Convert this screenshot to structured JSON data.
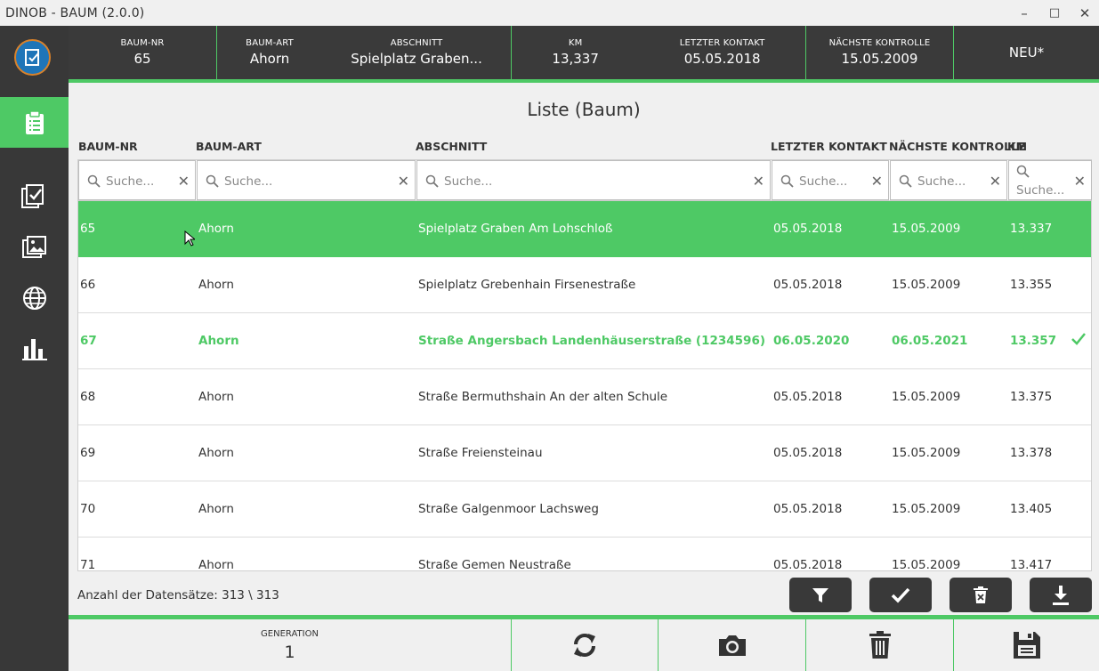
{
  "window": {
    "title": "DINOB - BAUM (2.0.0)",
    "minimize": "–",
    "maximize": "□",
    "close": "✕"
  },
  "header": {
    "baum_nr": {
      "label": "BAUM-NR",
      "value": "65"
    },
    "baum_art": {
      "label": "BAUM-ART",
      "value": "Ahorn"
    },
    "abschnitt": {
      "label": "ABSCHNITT",
      "value": "Spielplatz Graben..."
    },
    "km": {
      "label": "KM",
      "value": "13,337"
    },
    "letzter_kontakt": {
      "label": "LETZTER KONTAKT",
      "value": "05.05.2018"
    },
    "naechste_kontrolle": {
      "label": "NÄCHSTE KONTROLLE",
      "value": "15.05.2009"
    },
    "neu": "NEU*"
  },
  "list": {
    "title": "Liste (Baum)",
    "columns": [
      "BAUM-NR",
      "BAUM-ART",
      "ABSCHNITT",
      "LETZTER KONTAKT",
      "NÄCHSTE KONTROLLE",
      "KM"
    ],
    "search_placeholder": "Suche...",
    "rows": [
      {
        "nr": "65",
        "art": "Ahorn",
        "abschnitt": "Spielplatz Graben  Am Lohschloß",
        "kontakt": "05.05.2018",
        "kontrolle": "15.05.2009",
        "km": "13.337",
        "state": "selected"
      },
      {
        "nr": "66",
        "art": "Ahorn",
        "abschnitt": "Spielplatz Grebenhain  Firsenestraße",
        "kontakt": "05.05.2018",
        "kontrolle": "15.05.2009",
        "km": "13.355",
        "state": "normal"
      },
      {
        "nr": "67",
        "art": "Ahorn",
        "abschnitt": "Straße Angersbach  Landenhäuserstraße (1234596)",
        "kontakt": "06.05.2020",
        "kontrolle": "06.05.2021",
        "km": "13.357",
        "state": "checked"
      },
      {
        "nr": "68",
        "art": "Ahorn",
        "abschnitt": "Straße Bermuthshain  An der alten Schule",
        "kontakt": "05.05.2018",
        "kontrolle": "15.05.2009",
        "km": "13.375",
        "state": "normal"
      },
      {
        "nr": "69",
        "art": "Ahorn",
        "abschnitt": "Straße Freiensteinau",
        "kontakt": "05.05.2018",
        "kontrolle": "15.05.2009",
        "km": "13.378",
        "state": "normal"
      },
      {
        "nr": "70",
        "art": "Ahorn",
        "abschnitt": "Straße Galgenmoor  Lachsweg",
        "kontakt": "05.05.2018",
        "kontrolle": "15.05.2009",
        "km": "13.405",
        "state": "normal"
      },
      {
        "nr": "71",
        "art": "Ahorn",
        "abschnitt": "Straße Gemen  Neustraße",
        "kontakt": "05.05.2018",
        "kontrolle": "15.05.2009",
        "km": "13.417",
        "state": "normal"
      }
    ],
    "record_count": "Anzahl der Datensätze: 313 \\ 313"
  },
  "bottom": {
    "generation_label": "GENERATION",
    "generation_value": "1"
  },
  "colors": {
    "accent": "#4ec965",
    "dark": "#3a3a3a",
    "sidebar": "#383838"
  },
  "icons": {
    "sidebar": [
      "clipboard-icon",
      "checklist-icon",
      "images-icon",
      "globe-icon",
      "bar-chart-icon"
    ],
    "toolbar": [
      "filter-icon",
      "check-icon",
      "delete-icon",
      "download-icon"
    ],
    "bottom": [
      "refresh-icon",
      "camera-icon",
      "trash-icon",
      "save-icon"
    ]
  }
}
